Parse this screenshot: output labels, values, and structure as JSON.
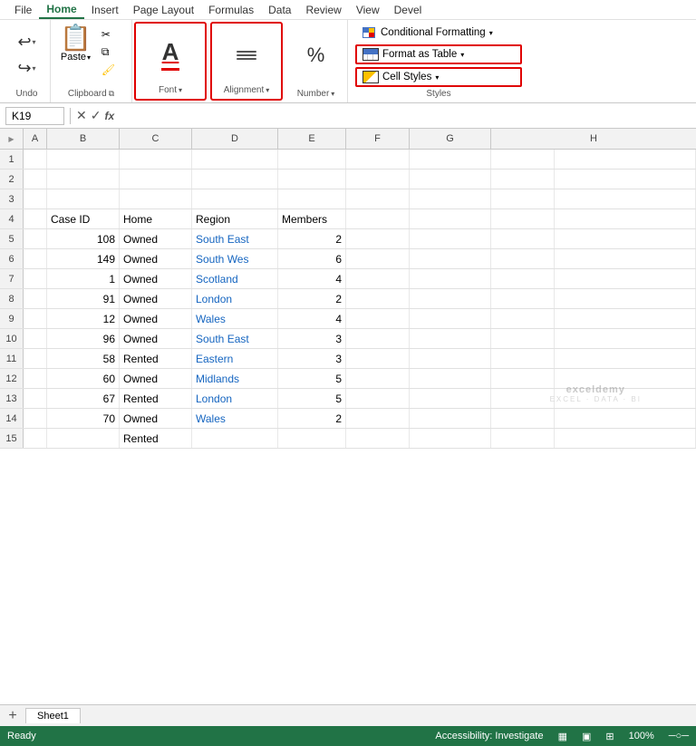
{
  "menubar": {
    "items": [
      "File",
      "Home",
      "Insert",
      "Page Layout",
      "Formulas",
      "Data",
      "Review",
      "View",
      "Devel"
    ]
  },
  "ribbon": {
    "undo_label": "Undo",
    "undo_icon": "↩",
    "redo_icon": "↪",
    "paste_label": "Paste",
    "clipboard_label": "Clipboard",
    "font_label": "Font",
    "alignment_label": "Alignment",
    "number_label": "Number",
    "styles_label": "Styles",
    "conditional_formatting": "Conditional Formatting",
    "format_as_table": "Format as Table",
    "cell_styles": "Cell Styles"
  },
  "formula_bar": {
    "cell_ref": "K19",
    "formula": ""
  },
  "columns": [
    "A",
    "B",
    "C",
    "D",
    "E",
    "F",
    "G",
    "H"
  ],
  "rows": [
    {
      "row": 1,
      "cells": [
        "",
        "",
        "",
        "",
        "",
        "",
        "",
        ""
      ]
    },
    {
      "row": 2,
      "cells": [
        "",
        "",
        "",
        "",
        "",
        "",
        "",
        ""
      ]
    },
    {
      "row": 3,
      "cells": [
        "",
        "",
        "",
        "",
        "",
        "",
        "",
        ""
      ]
    },
    {
      "row": 4,
      "cells": [
        "",
        "Case ID",
        "Home",
        "Region",
        "Members",
        "",
        "",
        ""
      ]
    },
    {
      "row": 5,
      "cells": [
        "",
        "108",
        "Owned",
        "South East",
        "2",
        "",
        "",
        ""
      ]
    },
    {
      "row": 6,
      "cells": [
        "",
        "149",
        "Owned",
        "South Wes",
        "6",
        "",
        "",
        ""
      ]
    },
    {
      "row": 7,
      "cells": [
        "",
        "1",
        "Owned",
        "Scotland",
        "4",
        "",
        "",
        ""
      ]
    },
    {
      "row": 8,
      "cells": [
        "",
        "91",
        "Owned",
        "London",
        "2",
        "",
        "",
        ""
      ]
    },
    {
      "row": 9,
      "cells": [
        "",
        "12",
        "Owned",
        "Wales",
        "4",
        "",
        "",
        ""
      ]
    },
    {
      "row": 10,
      "cells": [
        "",
        "96",
        "Owned",
        "South East",
        "3",
        "",
        "",
        ""
      ]
    },
    {
      "row": 11,
      "cells": [
        "",
        "58",
        "Rented",
        "Eastern",
        "3",
        "",
        "",
        ""
      ]
    },
    {
      "row": 12,
      "cells": [
        "",
        "60",
        "Owned",
        "Midlands",
        "5",
        "",
        "",
        ""
      ]
    },
    {
      "row": 13,
      "cells": [
        "",
        "67",
        "Rented",
        "London",
        "5",
        "",
        "",
        ""
      ]
    },
    {
      "row": 14,
      "cells": [
        "",
        "70",
        "Owned",
        "Wales",
        "2",
        "",
        "",
        ""
      ]
    },
    {
      "row": 15,
      "cells": [
        "",
        "",
        "Rented",
        "",
        "",
        "",
        "",
        ""
      ]
    }
  ],
  "sheet_tabs": [
    "Sheet1"
  ],
  "active_tab": "Sheet1",
  "status": {
    "ready": "Ready"
  }
}
